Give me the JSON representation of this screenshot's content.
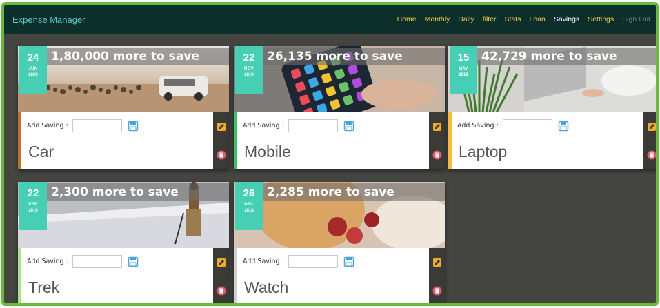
{
  "app": {
    "title": "Expense Manager"
  },
  "nav": {
    "items": [
      {
        "label": "Home",
        "state": "normal"
      },
      {
        "label": "Monthly",
        "state": "normal"
      },
      {
        "label": "Daily",
        "state": "normal"
      },
      {
        "label": "filter",
        "state": "normal"
      },
      {
        "label": "Stats",
        "state": "normal"
      },
      {
        "label": "Loan",
        "state": "normal"
      },
      {
        "label": "Savings",
        "state": "active"
      },
      {
        "label": "Settings",
        "state": "normal"
      },
      {
        "label": "Sign Out",
        "state": "muted"
      }
    ]
  },
  "cards": [
    {
      "name": "Car",
      "remaining_text": "1,80,000 more to save",
      "day": "24",
      "month": "JUN",
      "year": "2020",
      "add_label": "Add Saving :",
      "accent": "#b8742e",
      "photo": "desert-car"
    },
    {
      "name": "Mobile",
      "remaining_text": "26,135 more to save",
      "day": "22",
      "month": "NOV",
      "year": "2019",
      "add_label": "Add Saving :",
      "accent": "#39c268",
      "photo": "phone"
    },
    {
      "name": "Laptop",
      "remaining_text": "42,729 more to save",
      "day": "15",
      "month": "MAY",
      "year": "2019",
      "add_label": "Add Saving :",
      "accent": "#f2be42",
      "photo": "laptop"
    },
    {
      "name": "Trek",
      "remaining_text": "2,300 more to save",
      "day": "22",
      "month": "FEB",
      "year": "2019",
      "add_label": "Add Saving :",
      "accent": "#a9e08a",
      "photo": "snow-trek"
    },
    {
      "name": "Watch",
      "remaining_text": "2,285 more to save",
      "day": "26",
      "month": "DEC",
      "year": "2018",
      "add_label": "Add Saving :",
      "accent": "#cfcfcf",
      "photo": "roses"
    }
  ],
  "icons": {
    "save": "floppy-disk-icon",
    "edit": "edit-icon",
    "delete": "trash-icon"
  },
  "colors": {
    "navbar": "#0c2f2c",
    "brand": "#5fc6c4",
    "nav_link": "#f0cd48",
    "nav_active": "#ffffff",
    "nav_muted": "#6f8582",
    "background": "#444441",
    "frame_border": "#66bb3a",
    "date_badge": "#47cfb6",
    "edit_icon": "#f0a92a",
    "delete_icon": "#e05a6e"
  }
}
